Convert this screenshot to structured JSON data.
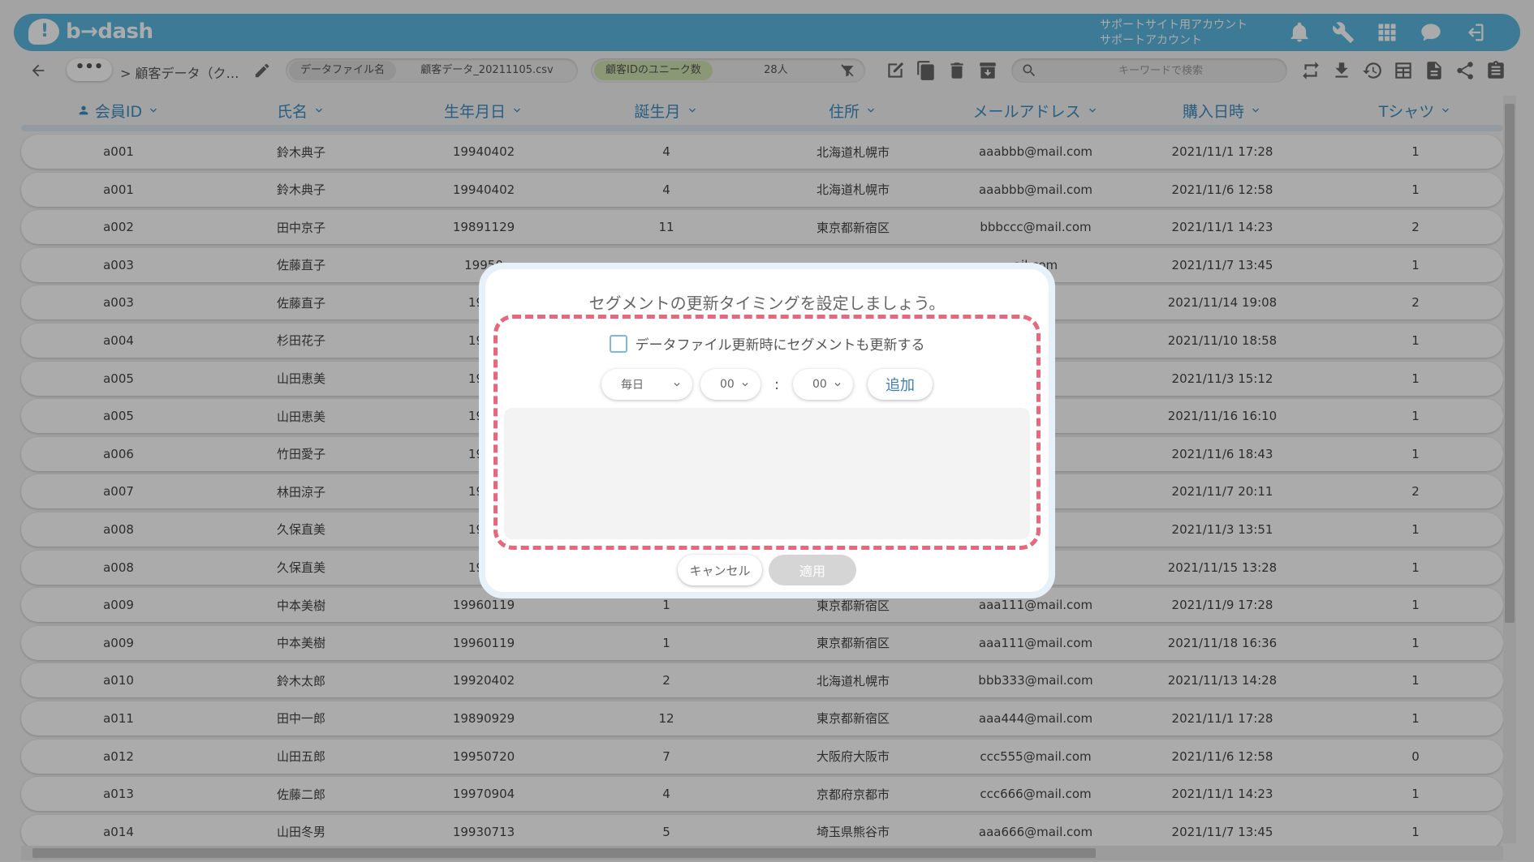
{
  "header": {
    "logo_text": "b→dash",
    "account_line1": "サポートサイト用アカウント",
    "account_line2": "サポートアカウント",
    "icons": [
      "bell-icon",
      "wrench-icon",
      "grid-icon",
      "chat-icon",
      "logout-icon"
    ]
  },
  "toolbar": {
    "more_label": "•••",
    "breadcrumb": "> 顧客データ（ク…",
    "datafile_label": "データファイル名",
    "datafile_value": "顧客データ_20211105.csv",
    "unique_label": "顧客IDのユニーク数",
    "unique_value": "28人",
    "search_placeholder": "キーワードで検索",
    "action_icons": [
      "edit-icon",
      "copy-icon",
      "trash-icon",
      "archive-icon"
    ],
    "right_icons": [
      "repeat-icon",
      "download-icon",
      "history-icon",
      "table-icon",
      "document-icon",
      "share-icon",
      "clipboard-icon"
    ]
  },
  "table": {
    "columns": [
      "会員ID",
      "氏名",
      "生年月日",
      "誕生月",
      "住所",
      "メールアドレス",
      "購入日時",
      "Tシャツ"
    ],
    "rows": [
      [
        "a001",
        "鈴木典子",
        "19940402",
        "4",
        "北海道札幌市",
        "aaabbb@mail.com",
        "2021/11/1 17:28",
        "1"
      ],
      [
        "a001",
        "鈴木典子",
        "19940402",
        "4",
        "北海道札幌市",
        "aaabbb@mail.com",
        "2021/11/6 12:58",
        "1"
      ],
      [
        "a002",
        "田中京子",
        "19891129",
        "11",
        "東京都新宿区",
        "bbbccc@mail.com",
        "2021/11/1 14:23",
        "2"
      ],
      [
        "a003",
        "佐藤直子",
        "19950",
        "",
        "",
        "ail.com",
        "2021/11/7 13:45",
        "1"
      ],
      [
        "a003",
        "佐藤直子",
        "1995",
        "",
        "",
        "l.com",
        "2021/11/14 19:08",
        "2"
      ],
      [
        "a004",
        "杉田花子",
        "1997",
        "",
        "",
        "l.com",
        "2021/11/10 18:58",
        "1"
      ],
      [
        "a005",
        "山田恵美",
        "1993",
        "",
        "",
        "l.com",
        "2021/11/3 15:12",
        "1"
      ],
      [
        "a005",
        "山田恵美",
        "1993",
        "",
        "",
        "l.com",
        "2021/11/16 16:10",
        "1"
      ],
      [
        "a006",
        "竹田愛子",
        "1992",
        "",
        "",
        "l.com",
        "2021/11/6 18:43",
        "1"
      ],
      [
        "a007",
        "林田涼子",
        "1999",
        "",
        "",
        ".com",
        "2021/11/7 20:11",
        "2"
      ],
      [
        "a008",
        "久保直美",
        "1996",
        "",
        "",
        "l.com",
        "2021/11/3 13:51",
        "1"
      ],
      [
        "a008",
        "久保直美",
        "1996",
        "",
        "",
        "l.com",
        "2021/11/15 13:28",
        "1"
      ],
      [
        "a009",
        "中本美樹",
        "19960119",
        "1",
        "東京都新宿区",
        "aaa111@mail.com",
        "2021/11/9 17:28",
        "1"
      ],
      [
        "a009",
        "中本美樹",
        "19960119",
        "1",
        "東京都新宿区",
        "aaa111@mail.com",
        "2021/11/18 16:36",
        "1"
      ],
      [
        "a010",
        "鈴木太郎",
        "19920402",
        "2",
        "北海道札幌市",
        "bbb333@mail.com",
        "2021/11/13 14:28",
        "1"
      ],
      [
        "a011",
        "田中一郎",
        "19890929",
        "12",
        "東京都新宿区",
        "aaa444@mail.com",
        "2021/11/1 17:28",
        "1"
      ],
      [
        "a012",
        "山田五郎",
        "19950720",
        "7",
        "大阪府大阪市",
        "ccc555@mail.com",
        "2021/11/6 12:58",
        "0"
      ],
      [
        "a013",
        "佐藤二郎",
        "19970904",
        "4",
        "京都府京都市",
        "ccc666@mail.com",
        "2021/11/1 14:23",
        "1"
      ],
      [
        "a014",
        "山田冬男",
        "19930713",
        "5",
        "埼玉県熊谷市",
        "aaa666@mail.com",
        "2021/11/7 13:45",
        "1"
      ]
    ]
  },
  "modal": {
    "title": "セグメントの更新タイミングを設定しましょう。",
    "checkbox_label": "データファイル更新時にセグメントも更新する",
    "checkbox_checked": false,
    "frequency_value": "毎日",
    "hour_value": "00",
    "minute_value": "00",
    "colon": ":",
    "add_label": "追加",
    "cancel_label": "キャンセル",
    "apply_label": "適用",
    "highlight_color": "#e8677a"
  }
}
